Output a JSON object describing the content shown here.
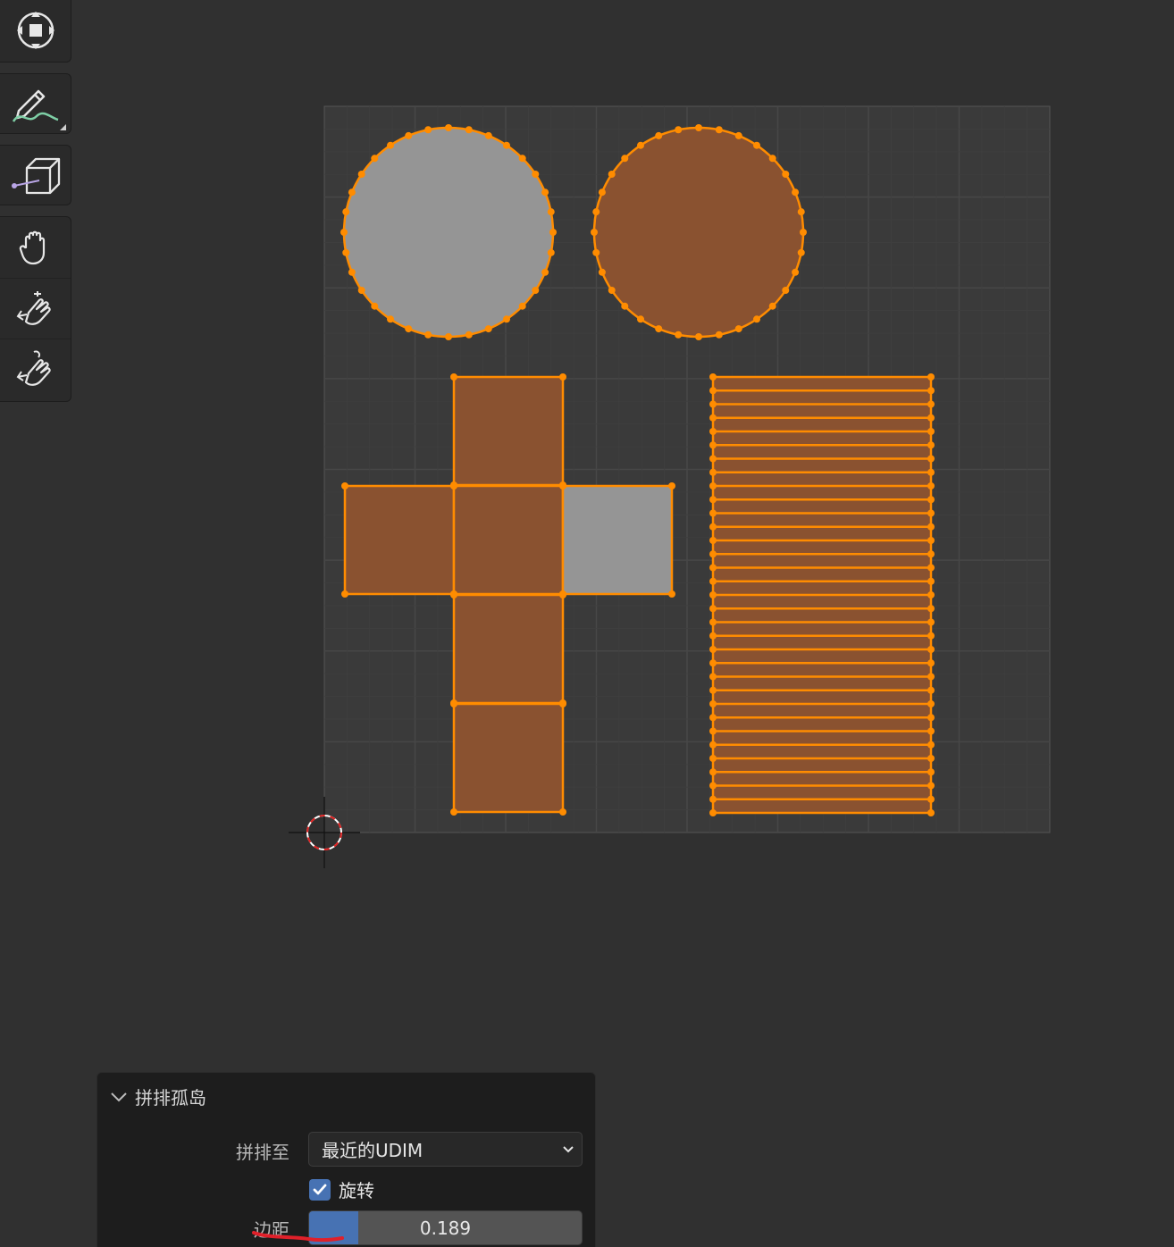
{
  "toolbar": {
    "groups": [
      {
        "tools": [
          {
            "name": "transform-tool",
            "icon": "transform-icon"
          }
        ]
      },
      {
        "tools": [
          {
            "name": "annotate-tool",
            "icon": "annotate-pencil-icon"
          }
        ]
      },
      {
        "tools": [
          {
            "name": "rip-tool",
            "icon": "rip-cube-icon"
          }
        ]
      },
      {
        "tools": [
          {
            "name": "grab-tool",
            "icon": "grab-hand-icon"
          },
          {
            "name": "relax-tool",
            "icon": "relax-hand-icon"
          },
          {
            "name": "pinch-tool",
            "icon": "pinch-hand-icon"
          }
        ]
      }
    ]
  },
  "uv_editor": {
    "colors": {
      "background": "#303030",
      "uv_space": "#3a3a3a",
      "grid": "#474747",
      "selected_face": "#8a5230",
      "unselected_face": "#959595",
      "edge": "#ff8c00",
      "vertex": "#ff8c00"
    },
    "islands": [
      {
        "name": "circle-island-left",
        "selected": false
      },
      {
        "name": "circle-island-right",
        "selected": true
      },
      {
        "name": "cube-cross-island",
        "selected": true,
        "unselected_faces": 1
      },
      {
        "name": "strip-grid-island",
        "selected": true,
        "rows": 32
      }
    ]
  },
  "operator_panel": {
    "title": "拼排孤岛",
    "pack_to_label": "拼排至",
    "pack_to_value": "最近的UDIM",
    "rotate_label": "旋转",
    "rotate_checked": true,
    "margin_label": "边距",
    "margin_value": "0.189",
    "margin_fill_fraction": 0.18,
    "accent": "#4772b3"
  }
}
